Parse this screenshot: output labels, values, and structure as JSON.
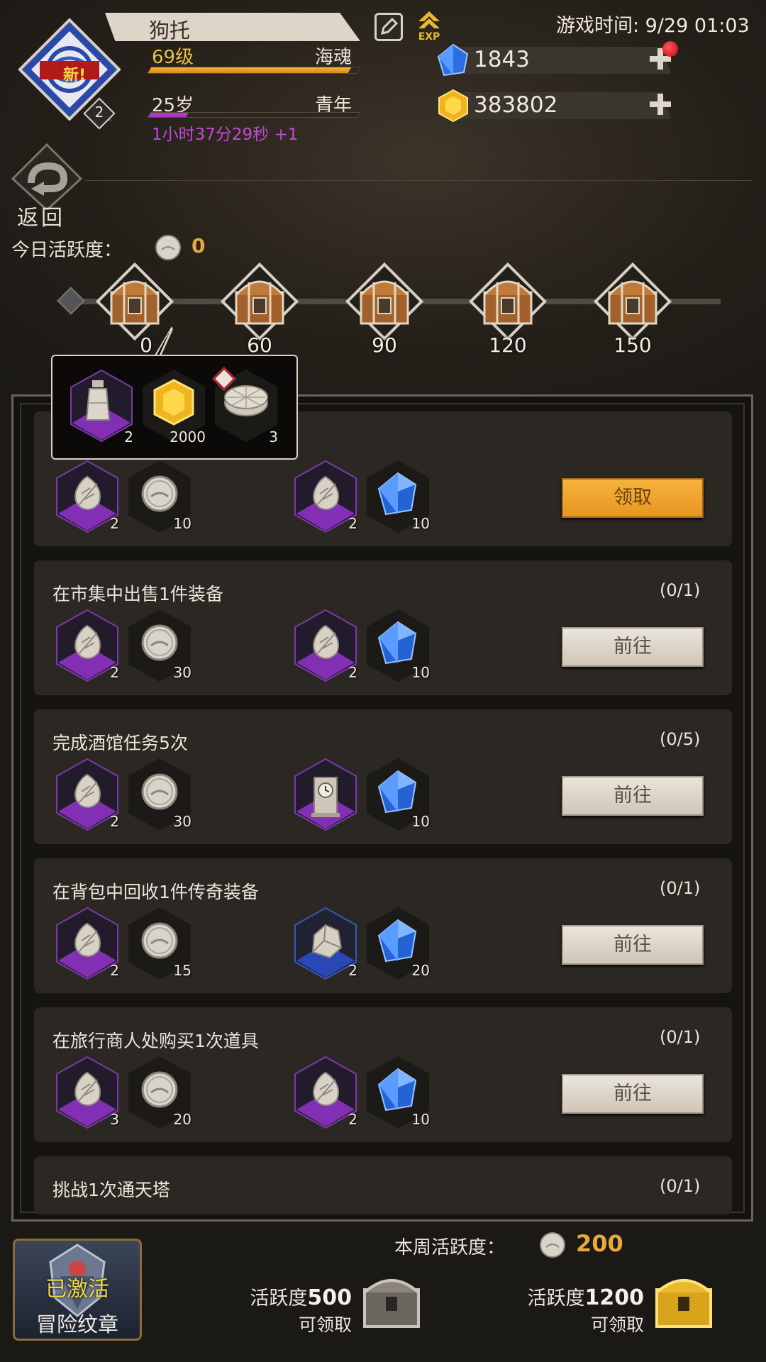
{
  "header": {
    "player_name": "狗托",
    "level_label": "69级",
    "soul_label": "海魂",
    "exp_progress": 0.96,
    "age_label": "25岁",
    "age_stage": "青年",
    "age_progress": 0.18,
    "timer_text": "1小时37分29秒 +1",
    "avatar_badge": "新!",
    "avatar_level": "2",
    "exp_icon_text": "EXP",
    "game_time": "游戏时间: 9/29 01:03"
  },
  "currency": {
    "gems": "1843",
    "gold": "383802"
  },
  "back_label": "返回",
  "today": {
    "label": "今日活跃度：",
    "value": "0"
  },
  "milestones": [
    "0",
    "60",
    "90",
    "120",
    "150"
  ],
  "popup": {
    "items": [
      {
        "icon": "potion-bottle-icon",
        "qty": "2"
      },
      {
        "icon": "gold-gem-icon",
        "qty": "2000"
      },
      {
        "icon": "silver-cake-icon",
        "qty": "3"
      }
    ]
  },
  "tasks": [
    {
      "title": "",
      "progress": "",
      "rewards": [
        {
          "icon": "silver-leaf-icon",
          "qty": "2"
        },
        {
          "icon": "silver-coin-icon",
          "qty": "10"
        },
        {
          "icon": "silver-leaf-icon",
          "qty": "2"
        },
        {
          "icon": "blue-gem-icon",
          "qty": "10"
        }
      ],
      "button": "领取",
      "gold": true
    },
    {
      "title": "在市集中出售1件装备",
      "progress": "(0/1)",
      "rewards": [
        {
          "icon": "silver-leaf-icon",
          "qty": "2"
        },
        {
          "icon": "silver-coin-icon",
          "qty": "30"
        },
        {
          "icon": "silver-leaf-icon",
          "qty": "2"
        },
        {
          "icon": "blue-gem-icon",
          "qty": "10"
        }
      ],
      "button": "前往",
      "gold": false
    },
    {
      "title": "完成酒馆任务5次",
      "progress": "(0/5)",
      "rewards": [
        {
          "icon": "silver-leaf-icon",
          "qty": "2"
        },
        {
          "icon": "silver-coin-icon",
          "qty": "30"
        },
        {
          "icon": "clock-icon",
          "qty": ""
        },
        {
          "icon": "blue-gem-icon",
          "qty": "10"
        }
      ],
      "button": "前往",
      "gold": false
    },
    {
      "title": "在背包中回收1件传奇装备",
      "progress": "(0/1)",
      "rewards": [
        {
          "icon": "silver-leaf-icon",
          "qty": "2"
        },
        {
          "icon": "silver-coin-icon",
          "qty": "15"
        },
        {
          "icon": "ore-rock-icon",
          "qty": "2"
        },
        {
          "icon": "blue-gem-icon",
          "qty": "20"
        }
      ],
      "button": "前往",
      "gold": false
    },
    {
      "title": "在旅行商人处购买1次道具",
      "progress": "(0/1)",
      "rewards": [
        {
          "icon": "silver-leaf-icon",
          "qty": "3"
        },
        {
          "icon": "silver-coin-icon",
          "qty": "20"
        },
        {
          "icon": "silver-leaf-icon",
          "qty": "2"
        },
        {
          "icon": "blue-gem-icon",
          "qty": "10"
        }
      ],
      "button": "前往",
      "gold": false
    },
    {
      "title": "挑战1次通天塔",
      "progress": "(0/1)",
      "rewards": [],
      "button": "",
      "gold": false
    }
  ],
  "badge": {
    "status": "已激活",
    "name": "冒险纹章"
  },
  "weekly": {
    "label": "本周活跃度：",
    "value": "200",
    "reward1_prefix": "活跃度",
    "reward1_value": "500",
    "reward1_sub": "可领取",
    "reward2_prefix": "活跃度",
    "reward2_value": "1200",
    "reward2_sub": "可领取"
  },
  "colors": {
    "accent_gold": "#e9a93a",
    "timer_purple": "#c04bd6",
    "level_yellow": "#e8c24a"
  }
}
